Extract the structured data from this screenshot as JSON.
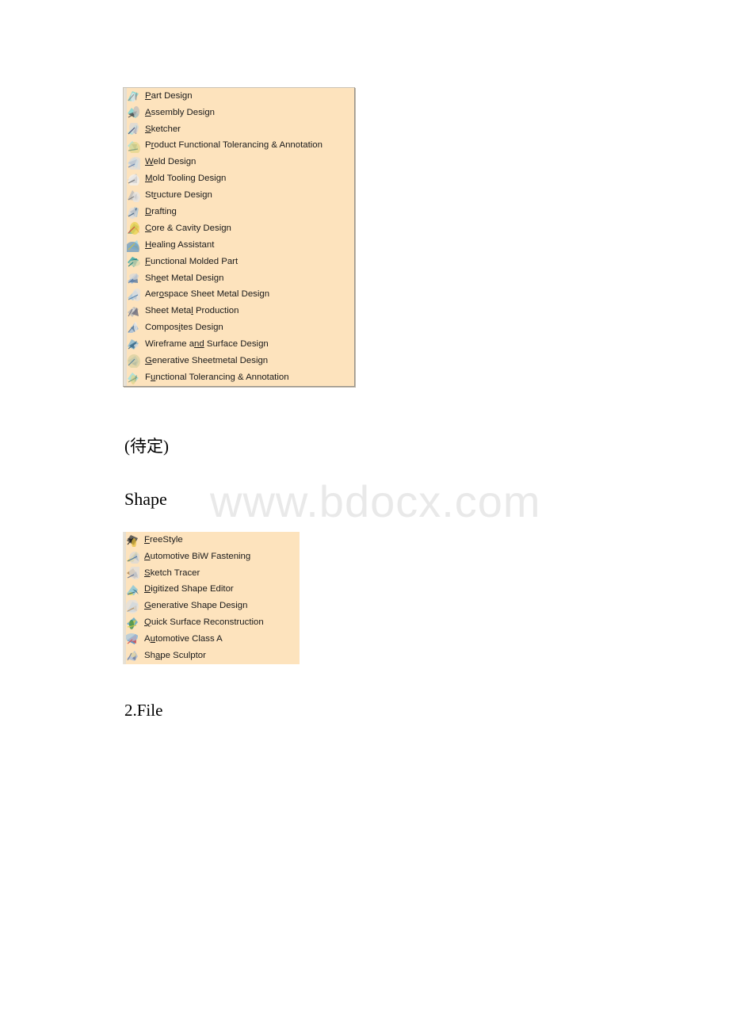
{
  "page": {
    "background": "#ffffff",
    "menu_background": "#fde3bd",
    "watermark": "www.bdocx.com"
  },
  "prose": {
    "pending": "(待定)",
    "shape_heading": "Shape",
    "file_heading": "2.File"
  },
  "menus": [
    {
      "id": "infrastructure-mechanical-design-menu",
      "items": [
        {
          "icon": "part-design-icon",
          "pre": "",
          "accel": "P",
          "post": "art Design"
        },
        {
          "icon": "assembly-design-icon",
          "pre": "",
          "accel": "A",
          "post": "ssembly Design"
        },
        {
          "icon": "sketcher-icon",
          "pre": "",
          "accel": "S",
          "post": "ketcher"
        },
        {
          "icon": "product-functional-tolerancing-icon",
          "pre": "P",
          "accel": "r",
          "post": "oduct Functional Tolerancing & Annotation"
        },
        {
          "icon": "weld-design-icon",
          "pre": "",
          "accel": "W",
          "post": "eld Design"
        },
        {
          "icon": "mold-tooling-design-icon",
          "pre": "",
          "accel": "M",
          "post": "old Tooling Design"
        },
        {
          "icon": "structure-design-icon",
          "pre": "St",
          "accel": "r",
          "post": "ucture Design"
        },
        {
          "icon": "drafting-icon",
          "pre": "",
          "accel": "D",
          "post": "rafting"
        },
        {
          "icon": "core-cavity-design-icon",
          "pre": "",
          "accel": "C",
          "post": "ore & Cavity Design"
        },
        {
          "icon": "healing-assistant-icon",
          "pre": "",
          "accel": "H",
          "post": "ealing Assistant"
        },
        {
          "icon": "functional-molded-part-icon",
          "pre": "",
          "accel": "F",
          "post": "unctional Molded Part"
        },
        {
          "icon": "sheet-metal-design-icon",
          "pre": "Sh",
          "accel": "e",
          "post": "et Metal Design"
        },
        {
          "icon": "aerospace-sheet-metal-design-icon",
          "pre": "Aer",
          "accel": "o",
          "post": "space Sheet Metal  Design"
        },
        {
          "icon": "sheet-metal-production-icon",
          "pre": "Sheet Meta",
          "accel": "l",
          "post": " Production"
        },
        {
          "icon": "composites-design-icon",
          "pre": "Compos",
          "accel": "i",
          "post": "tes Design"
        },
        {
          "icon": "wireframe-surface-design-icon",
          "pre": "Wireframe a",
          "accel": "nd",
          "post": " Surface Design"
        },
        {
          "icon": "generative-sheetmetal-design-icon",
          "pre": "",
          "accel": "G",
          "post": "enerative Sheetmetal Design"
        },
        {
          "icon": "functional-tolerancing-annotation-icon",
          "pre": "F",
          "accel": "u",
          "post": "nctional Tolerancing & Annotation"
        }
      ]
    },
    {
      "id": "shape-menu",
      "items": [
        {
          "icon": "freestyle-icon",
          "pre": "",
          "accel": "F",
          "post": "reeStyle"
        },
        {
          "icon": "automotive-biw-fastening-icon",
          "pre": "",
          "accel": "A",
          "post": "utomotive BiW Fastening"
        },
        {
          "icon": "sketch-tracer-icon",
          "pre": "",
          "accel": "S",
          "post": "ketch Tracer"
        },
        {
          "icon": "digitized-shape-editor-icon",
          "pre": "",
          "accel": "D",
          "post": "igitized Shape Editor"
        },
        {
          "icon": "generative-shape-design-icon",
          "pre": "",
          "accel": "G",
          "post": "enerative Shape Design"
        },
        {
          "icon": "quick-surface-reconstruction-icon",
          "pre": "",
          "accel": "Q",
          "post": "uick Surface Reconstruction"
        },
        {
          "icon": "automotive-class-a-icon",
          "pre": "A",
          "accel": "u",
          "post": "tomotive Class A"
        },
        {
          "icon": "shape-sculptor-icon",
          "pre": "Sh",
          "accel": "a",
          "post": "pe Sculptor"
        }
      ]
    }
  ]
}
